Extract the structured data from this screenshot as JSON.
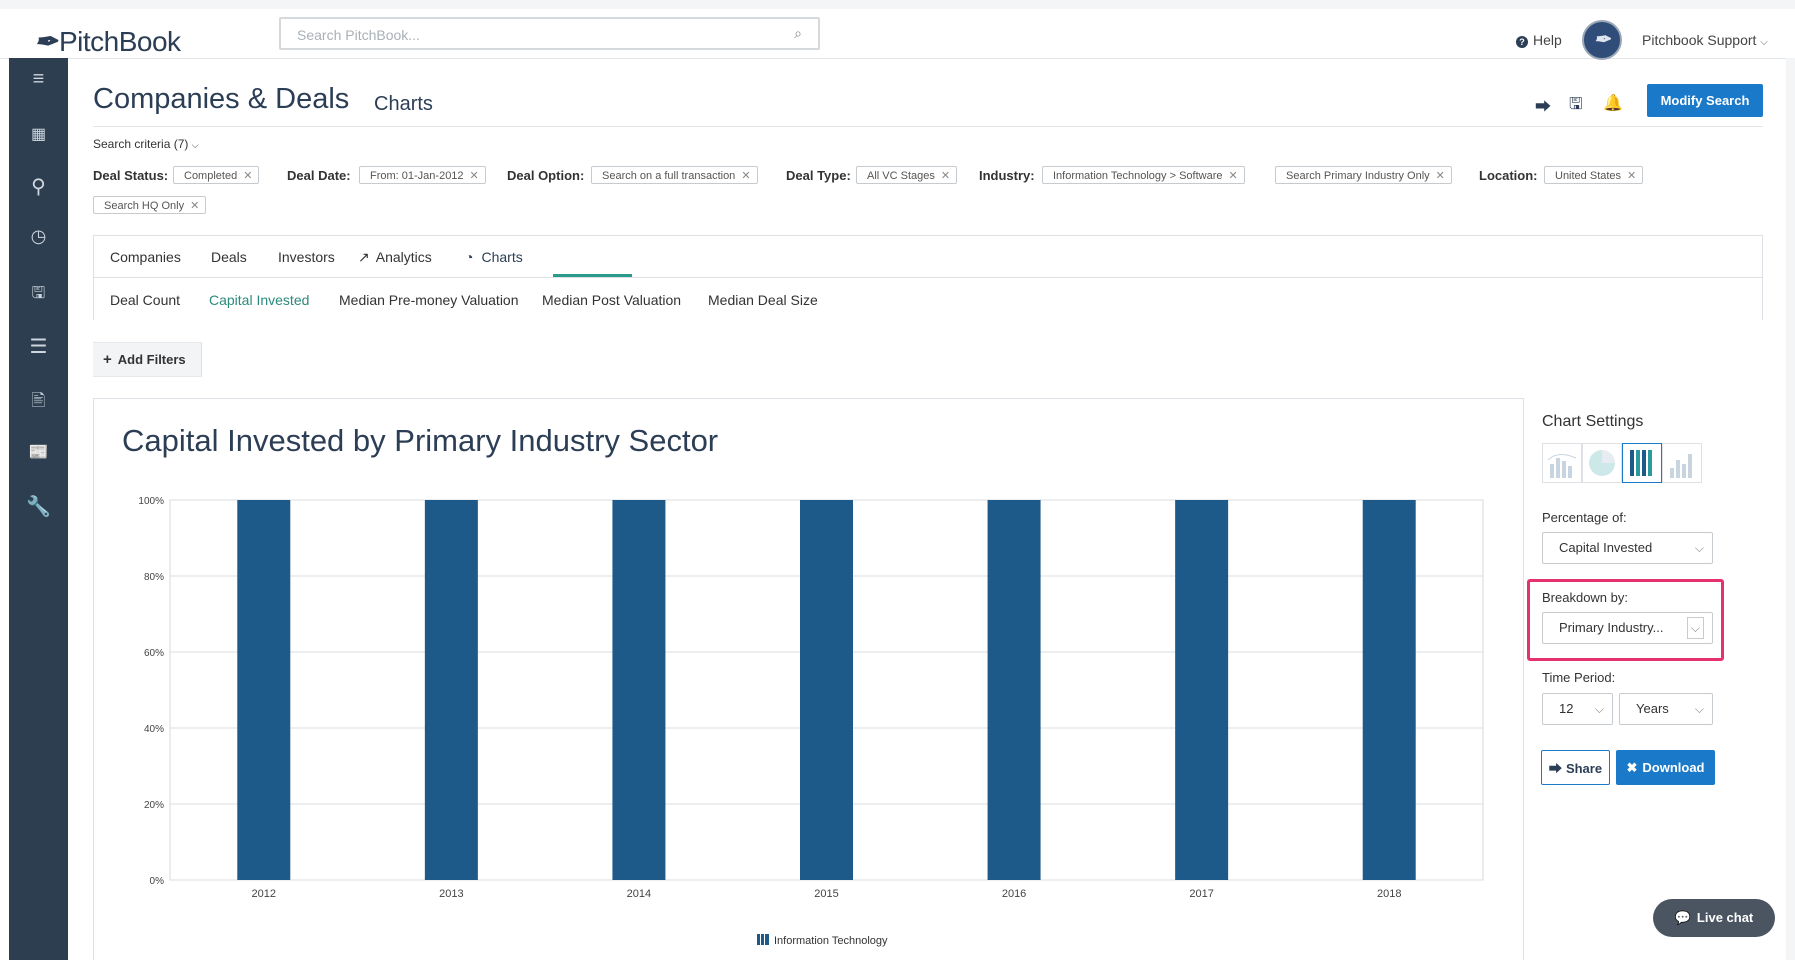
{
  "app": {
    "logo_text": "PitchBook"
  },
  "search": {
    "placeholder": "Search PitchBook..."
  },
  "header": {
    "help": "Help",
    "user": "Pitchbook Support"
  },
  "page": {
    "title": "Companies & Deals",
    "subtitle": "Charts",
    "modify_search": "Modify Search"
  },
  "criteria": {
    "toggle": "Search criteria (7)",
    "items": [
      {
        "label": "Deal Status:",
        "chips": [
          "Completed"
        ]
      },
      {
        "label": "Deal Date:",
        "chips": [
          "From: 01-Jan-2012"
        ]
      },
      {
        "label": "Deal Option:",
        "chips": [
          "Search on a full transaction"
        ]
      },
      {
        "label": "Deal Type:",
        "chips": [
          "All VC Stages"
        ]
      },
      {
        "label": "Industry:",
        "chips": [
          "Information Technology > Software",
          "Search Primary Industry Only"
        ]
      },
      {
        "label": "Location:",
        "chips": [
          "United States",
          "Search HQ Only"
        ]
      }
    ]
  },
  "tabs": [
    "Companies",
    "Deals",
    "Investors",
    "Analytics",
    "Charts"
  ],
  "active_tab": "Charts",
  "subtabs": [
    "Deal Count",
    "Capital Invested",
    "Median Pre-money Valuation",
    "Median Post Valuation",
    "Median Deal Size"
  ],
  "active_subtab": "Capital Invested",
  "add_filters": "Add Filters",
  "settings": {
    "title": "Chart Settings",
    "percentage_label": "Percentage of:",
    "percentage_value": "Capital Invested",
    "breakdown_label": "Breakdown by:",
    "breakdown_value": "Primary Industry...",
    "time_label": "Time Period:",
    "time_count": "12",
    "time_unit": "Years",
    "share": "Share",
    "download": "Download"
  },
  "chart_data": {
    "type": "bar",
    "stacked": true,
    "title": "Capital Invested by Primary Industry Sector",
    "categories": [
      "2012",
      "2013",
      "2014",
      "2015",
      "2016",
      "2017",
      "2018"
    ],
    "series": [
      {
        "name": "Information Technology",
        "values": [
          100,
          100,
          100,
          100,
          100,
          100,
          100
        ],
        "color": "#1d5a8a"
      }
    ],
    "yticks": [
      "0%",
      "20%",
      "40%",
      "60%",
      "80%",
      "100%"
    ],
    "ylim": [
      0,
      100
    ],
    "grid": true,
    "legend_position": "bottom"
  },
  "live_chat": "Live chat",
  "colors": {
    "sidebar": "#2c3e50",
    "accent": "#1b79c9",
    "highlight": "#e5316f",
    "bar": "#1d5a8a"
  }
}
